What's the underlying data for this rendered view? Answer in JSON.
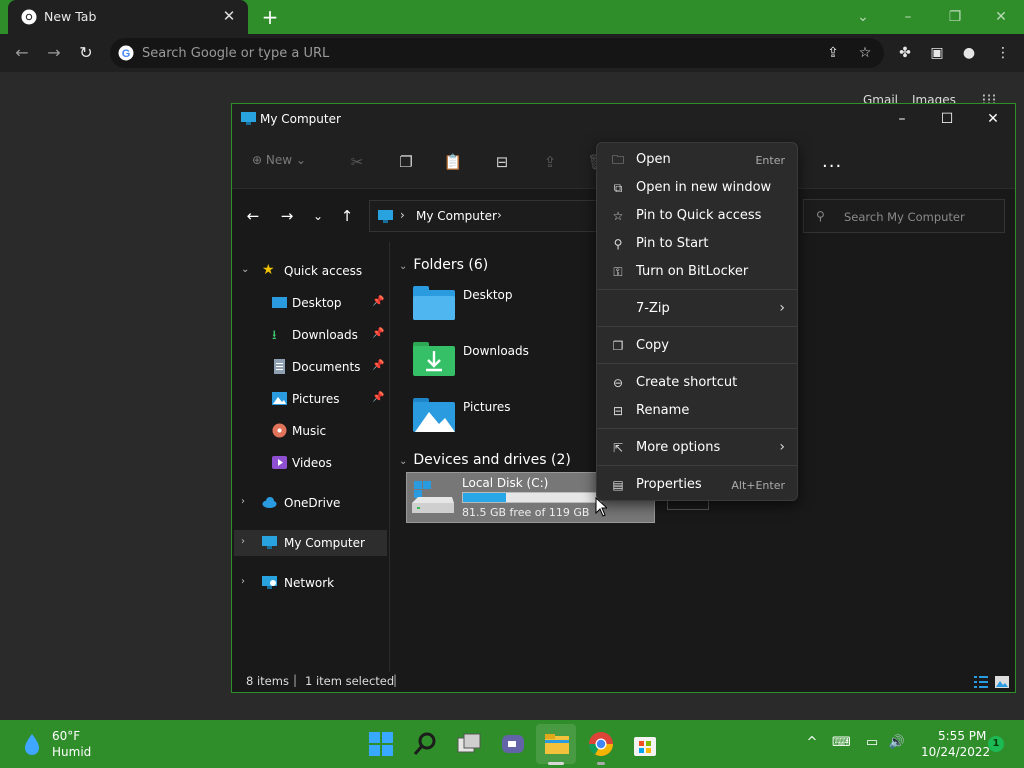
{
  "browser": {
    "tab_title": "New Tab",
    "omnibox_placeholder": "Search Google or type a URL",
    "ntp_links": [
      "Gmail",
      "Images"
    ]
  },
  "explorer": {
    "window_title": "My Computer",
    "toolbar": {
      "new_label": "New",
      "more_label": "..."
    },
    "address": {
      "crumb": "My Computer"
    },
    "search_placeholder": "Search My Computer",
    "nav": [
      {
        "label": "Quick access"
      },
      {
        "label": "Desktop"
      },
      {
        "label": "Downloads"
      },
      {
        "label": "Documents"
      },
      {
        "label": "Pictures"
      },
      {
        "label": "Music"
      },
      {
        "label": "Videos"
      },
      {
        "label": "OneDrive"
      },
      {
        "label": "My Computer"
      },
      {
        "label": "Network"
      }
    ],
    "folders_header": "Folders (6)",
    "folders": [
      {
        "label": "Desktop"
      },
      {
        "label": "Downloads"
      },
      {
        "label": "Pictures"
      }
    ],
    "devices_header": "Devices and drives (2)",
    "drive": {
      "name": "Local Disk (C:)",
      "free_text": "81.5 GB free of 119 GB",
      "used_fraction": 0.315
    },
    "status": {
      "items": "8 items",
      "selected": "1 item selected"
    }
  },
  "context_menu": {
    "items": [
      {
        "label": "Open",
        "shortcut": "Enter",
        "icon": "open-icon"
      },
      {
        "label": "Open in new window",
        "icon": "new-window-icon"
      },
      {
        "label": "Pin to Quick access",
        "icon": "star-icon"
      },
      {
        "label": "Pin to Start",
        "icon": "pin-icon"
      },
      {
        "label": "Turn on BitLocker",
        "icon": "key-icon"
      },
      {
        "label": "7-Zip",
        "icon": ""
      },
      {
        "label": "Copy",
        "icon": "copy-icon"
      },
      {
        "label": "Create shortcut",
        "icon": "link-icon"
      },
      {
        "label": "Rename",
        "icon": "rename-icon"
      },
      {
        "label": "More options",
        "icon": "share-icon"
      },
      {
        "label": "Properties",
        "shortcut": "Alt+Enter",
        "icon": "properties-icon"
      }
    ]
  },
  "taskbar": {
    "weather_temp": "60°F",
    "weather_desc": "Humid",
    "time": "5:55 PM",
    "date": "10/24/2022",
    "notification_count": "1"
  },
  "colors": {
    "accent": "#2f8e2a",
    "drive_fill": "#28a7e8"
  }
}
